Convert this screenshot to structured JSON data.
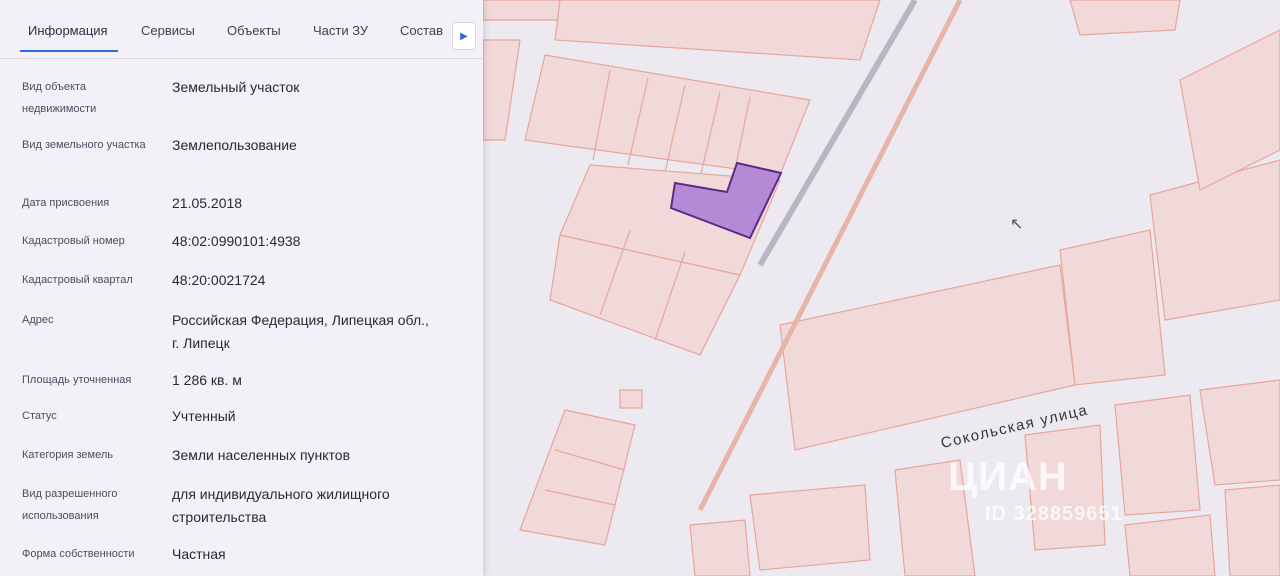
{
  "tabs": [
    "Информация",
    "Сервисы",
    "Объекты",
    "Части ЗУ",
    "Состав"
  ],
  "tab_next_icon": "chevron-right-icon",
  "fields": [
    {
      "label": "Вид объекта недвижимости",
      "value": "Земельный участок"
    },
    {
      "label": "Вид земельного участка",
      "value": "Землепользование"
    },
    {
      "label": "Дата присвоения",
      "value": "21.05.2018"
    },
    {
      "label": "Кадастровый номер",
      "value": "48:02:0990101:4938"
    },
    {
      "label": "Кадастровый квартал",
      "value": "48:20:0021724"
    },
    {
      "label": "Адрес",
      "value": "Российская Федерация, Липецкая обл., г. Липецк"
    },
    {
      "label": "Площадь уточненная",
      "value": "1 286 кв. м"
    },
    {
      "label": "Статус",
      "value": "Учтенный"
    },
    {
      "label": "Категория земель",
      "value": "Земли населенных пунктов"
    },
    {
      "label": "Вид разрешенного использования",
      "value": "для индивидуального жилищного строительства"
    },
    {
      "label": "Форма собственности",
      "value": "Частная"
    }
  ],
  "map": {
    "street_label": "Сокольская улица",
    "watermark_logo": "ЦИАН",
    "watermark_id": "ID 328859651",
    "colors": {
      "parcel_fill": "#f1d9d9",
      "parcel_border": "#e8a59a",
      "selected_fill": "#b48ad6",
      "selected_border": "#5b2a83",
      "background": "#eceaf0"
    }
  }
}
